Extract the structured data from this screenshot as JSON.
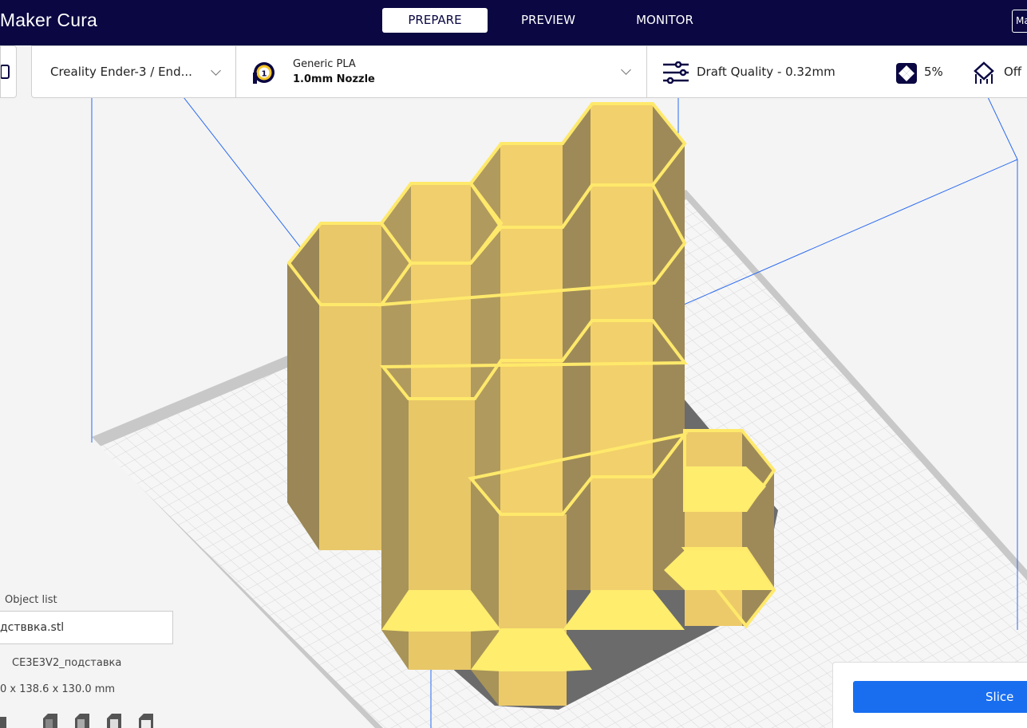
{
  "app": {
    "title": "tiMaker Cura",
    "account_button": "Ma"
  },
  "tabs": [
    {
      "label": "PREPARE",
      "active": true
    },
    {
      "label": "PREVIEW",
      "active": false
    },
    {
      "label": "MONITOR",
      "active": false
    }
  ],
  "printer": {
    "name": "Creality Ender-3 / End..."
  },
  "material": {
    "extruder_number": "1",
    "name": "Generic PLA",
    "nozzle": "1.0mm Nozzle"
  },
  "print_settings": {
    "profile": "Draft Quality - 0.32mm",
    "infill": "5%",
    "support": "Off"
  },
  "object_list": {
    "title": "Object list",
    "file": "дстввка.stl",
    "object_name": "CE3E3V2_подставка",
    "dimensions": "0 x 138.6 x 130.0 mm"
  },
  "slice": {
    "label": "Slice"
  },
  "colors": {
    "header": "#0a0742",
    "accent": "#196ef0",
    "model": "#f2cf66"
  }
}
